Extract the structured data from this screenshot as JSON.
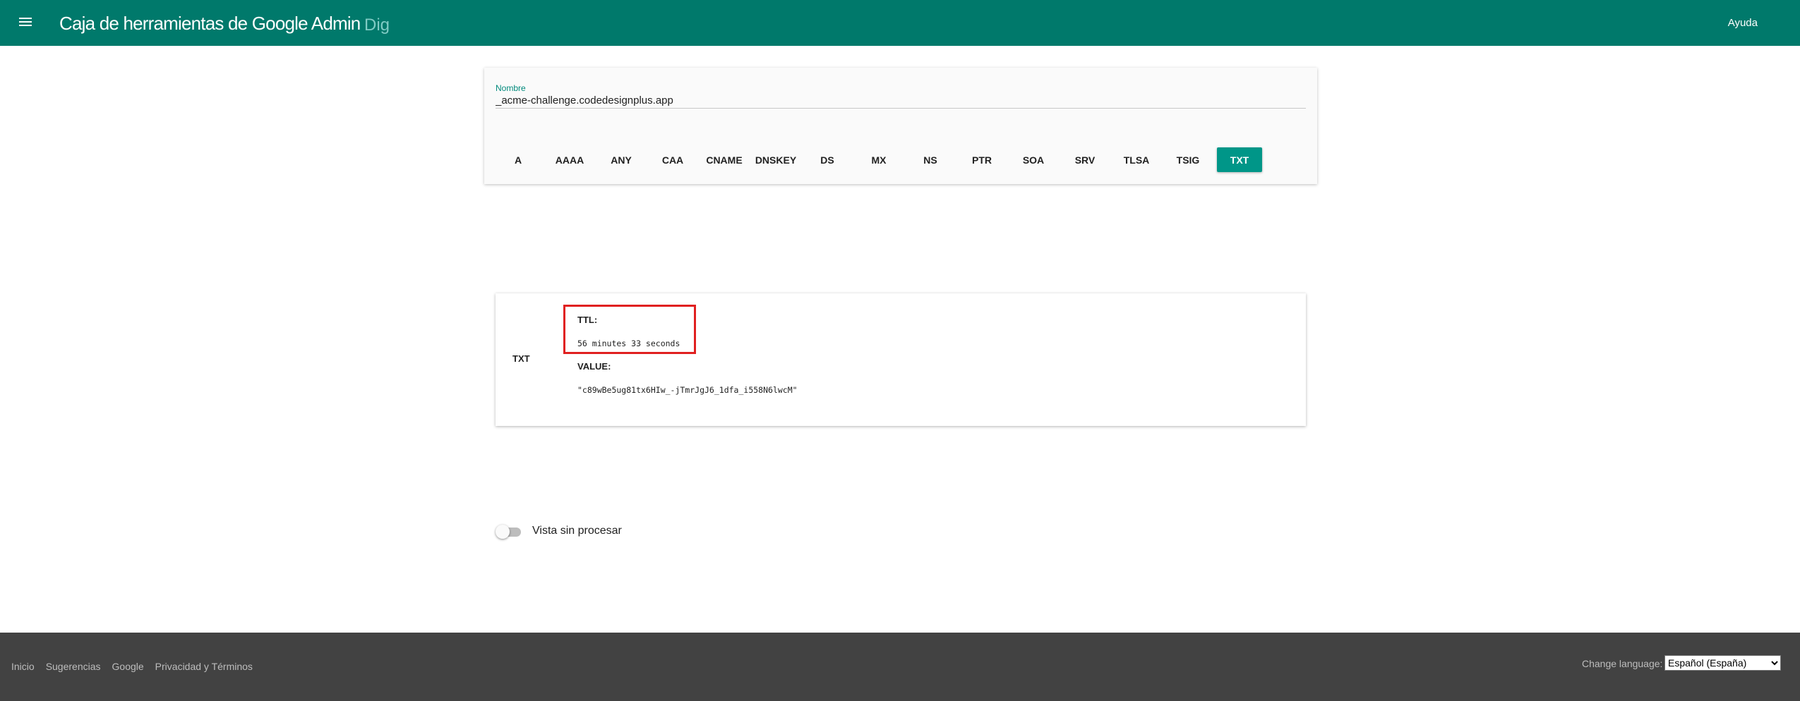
{
  "header": {
    "title": "Caja de herramientas de Google Admin",
    "subtitle": "Dig",
    "help_label": "Ayuda",
    "menu_icon": "menu-icon",
    "bg_color": "#00796b"
  },
  "query": {
    "name_label": "Nombre",
    "name_value": "_acme-challenge.codedesignplus.app",
    "record_types": [
      "A",
      "AAAA",
      "ANY",
      "CAA",
      "CNAME",
      "DNSKEY",
      "DS",
      "MX",
      "NS",
      "PTR",
      "SOA",
      "SRV",
      "TLSA",
      "TSIG",
      "TXT"
    ],
    "selected_type": "TXT",
    "accent_color": "#009688"
  },
  "result": {
    "record_type": "TXT",
    "ttl_label": "TTL:",
    "ttl_value": "56 minutes 33 seconds",
    "value_label": "VALUE:",
    "value_text": "\"c89wBe5ug81tx6HIw_-jTmrJgJ6_1dfa_i558N6lwcM\"",
    "highlight_color": "#e02020"
  },
  "raw_view": {
    "label": "Vista sin procesar",
    "enabled": false
  },
  "footer": {
    "links": [
      "Inicio",
      "Sugerencias",
      "Google",
      "Privacidad y Términos"
    ],
    "language_label": "Change language:",
    "language_value": "Español (España)"
  }
}
